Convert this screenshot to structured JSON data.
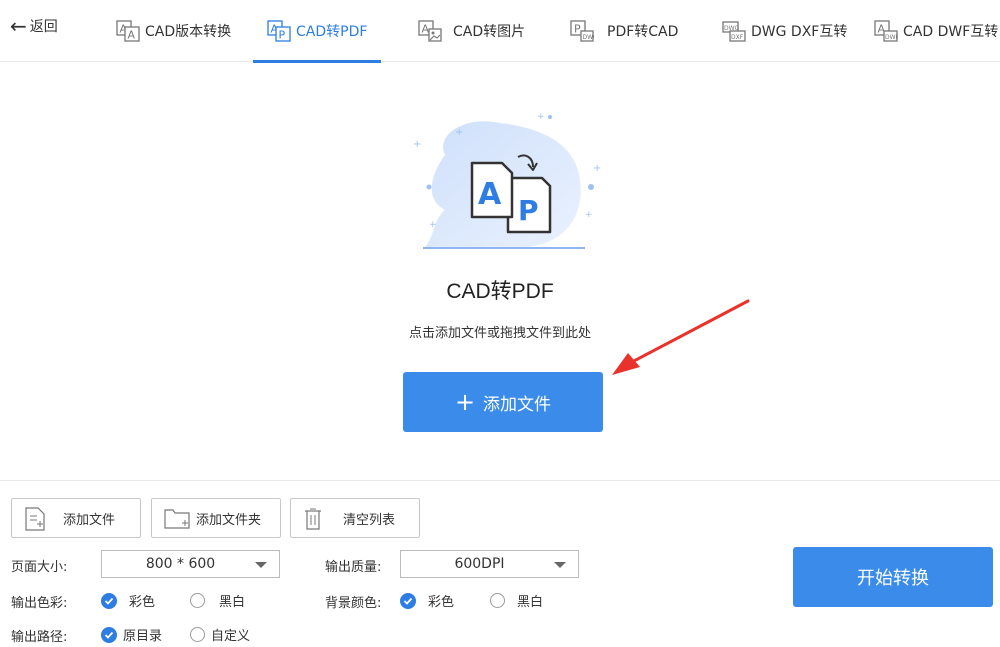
{
  "header": {
    "back_label": "返回",
    "tabs": [
      {
        "label": "CAD版本转换",
        "icon": "cad-version-icon",
        "active": false
      },
      {
        "label": "CAD转PDF",
        "icon": "cad-to-pdf-icon",
        "active": true
      },
      {
        "label": "CAD转图片",
        "icon": "cad-to-image-icon",
        "active": false
      },
      {
        "label": "PDF转CAD",
        "icon": "pdf-to-cad-icon",
        "active": false
      },
      {
        "label": "DWG DXF互转",
        "icon": "dwg-dxf-icon",
        "active": false
      },
      {
        "label": "CAD DWF互转",
        "icon": "cad-dwf-icon",
        "active": false
      }
    ]
  },
  "hero": {
    "title": "CAD转PDF",
    "hint": "点击添加文件或拖拽文件到此处",
    "add_button": "添加文件",
    "illustration_letters": {
      "front": "A",
      "back": "P"
    }
  },
  "toolbar": {
    "add_file": "添加文件",
    "add_folder": "添加文件夹",
    "clear_list": "清空列表"
  },
  "settings": {
    "page_size_label": "页面大小:",
    "page_size_value": "800 * 600",
    "quality_label": "输出质量:",
    "quality_value": "600DPI",
    "color_label": "输出色彩:",
    "color_options": [
      {
        "label": "彩色",
        "selected": true
      },
      {
        "label": "黑白",
        "selected": false
      }
    ],
    "bg_label": "背景颜色:",
    "bg_options": [
      {
        "label": "彩色",
        "selected": true
      },
      {
        "label": "黑白",
        "selected": false
      }
    ],
    "path_label": "输出路径:",
    "path_options": [
      {
        "label": "原目录",
        "selected": true
      },
      {
        "label": "自定义",
        "selected": false
      }
    ]
  },
  "start_button": "开始转换",
  "colors": {
    "accent": "#2d7de2",
    "button": "#3b8cea",
    "annotation_arrow": "#e8322b"
  }
}
